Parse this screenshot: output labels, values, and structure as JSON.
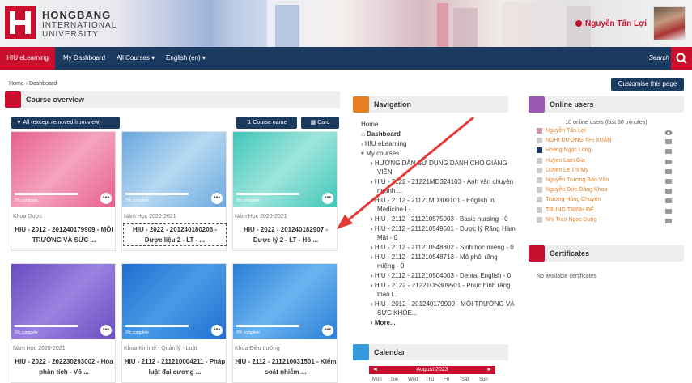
{
  "brand": {
    "name_line1": "HONGBANG",
    "name_line2": "INTERNATIONAL",
    "name_line3": "UNIVERSITY",
    "accent": "#c8102e",
    "navy": "#1b3a60"
  },
  "user": {
    "name": "Nguyễn Tấn Lợi"
  },
  "navbar": {
    "items": [
      "HIU eLearning",
      "My Dashboard",
      "All Courses ▾",
      "English (en) ▾"
    ],
    "search_label": "Search"
  },
  "breadcrumb": {
    "home": "Home",
    "sep": "›",
    "current": "Dashboard"
  },
  "customise_label": "Customise this page",
  "course_overview": {
    "title": "Course overview",
    "filter_label": "All (except removed from view)",
    "sort_label": "Course name",
    "view_label": "Card",
    "cards": [
      {
        "category": "Khoa Dược",
        "name": "HIU - 2012 - 201240179909 - MÔI TRƯỜNG VÀ SỨC ...",
        "complete": "0% complete",
        "color1": "#e8608c",
        "color2": "#f4a3be"
      },
      {
        "category": "Năm Học 2020-2021",
        "name": "HIU - 2022 - 201240180206 - Dược liệu 2 - LT - ...",
        "complete": "0% complete",
        "color1": "#6aa8de",
        "color2": "#b6d8f2"
      },
      {
        "category": "Năm Học 2020-2021",
        "name": "HIU - 2022 - 201240182907 - Dược lý 2 - LT - Hồ ...",
        "complete": "0% complete",
        "color1": "#3fc6b8",
        "color2": "#9fe5dc"
      },
      {
        "category": "Năm Học 2020-2021",
        "name": "HIU - 2022 - 202230293002 - Hóa phân tích - Võ ...",
        "complete": "0% complete",
        "color1": "#6a4cc0",
        "color2": "#9a82e0"
      },
      {
        "category": "Khoa Kinh tế - Quản lý - Luật",
        "name": "HIU - 2112 - 211210004211 - Pháp luật đại cương ...",
        "complete": "0% complete",
        "color1": "#1d6fd0",
        "color2": "#4a9ae6"
      },
      {
        "category": "Khoa Điều dưỡng",
        "name": "HIU - 2112 - 211210031501 - Kiểm soát nhiễm ...",
        "complete": "0% complete",
        "color1": "#2a7fd6",
        "color2": "#6bb2ef"
      }
    ]
  },
  "navigation": {
    "title": "Navigation",
    "home": "Home",
    "dashboard": "Dashboard",
    "site": "HIU eLearning",
    "my_courses": "My courses",
    "courses": [
      [
        "HƯỚNG DẪN SỬ DỤNG DÀNH CHO GIẢNG",
        "VIÊN"
      ],
      [
        "HIU - 2122 - 21221MD324103 - Anh văn chuyên",
        "ngành ..."
      ],
      [
        "HIU - 2112 - 21121MD300101 - English in",
        "Medicine I -"
      ],
      [
        "HIU - 2112 - 211210575003 - Basic nursing - 0"
      ],
      [
        "HIU - 2112 - 211210549601 - Dược lý Răng Hàm",
        "Mặt - 0"
      ],
      [
        "HIU - 2112 - 211210548802 - Sinh học miệng - 0"
      ],
      [
        "HIU - 2112 - 211210548713 - Mô phôi răng",
        "miệng - 0"
      ],
      [
        "HIU - 2112 - 211210504003 - Dental English - 0"
      ],
      [
        "HIU - 2122 - 21221OS309501 - Phục hình răng",
        "tháo l..."
      ],
      [
        "HIU - 2012 - 201240179909 - MÔI TRƯỜNG VÀ",
        "SỨC KHỎE..."
      ]
    ],
    "more": "More..."
  },
  "calendar": {
    "title": "Calendar",
    "month": "August 2023",
    "days": [
      "Mon",
      "Tue",
      "Wed",
      "Thu",
      "Fri",
      "Sat",
      "Sun"
    ]
  },
  "online_users": {
    "title": "Online users",
    "subtitle": "10 online users (last 30 minutes)",
    "users": [
      "Nguyễn Tấn Lợi",
      "NGHI DƯƠNG THỊ XUÂN",
      "Hoàng Ngọc Long",
      "Huyen Lam Gia",
      "Duyen Le Thi My",
      "Nguyễn Trương Bảo Vân",
      "Nguyễn Đức Đăng Khoa",
      "Trương Hồng Chuyên",
      "TRUNG TRINH ĐẾ",
      "Nhi Tran Ngoc Dung"
    ]
  },
  "certificates": {
    "title": "Certificates",
    "empty": "No available certificates"
  }
}
